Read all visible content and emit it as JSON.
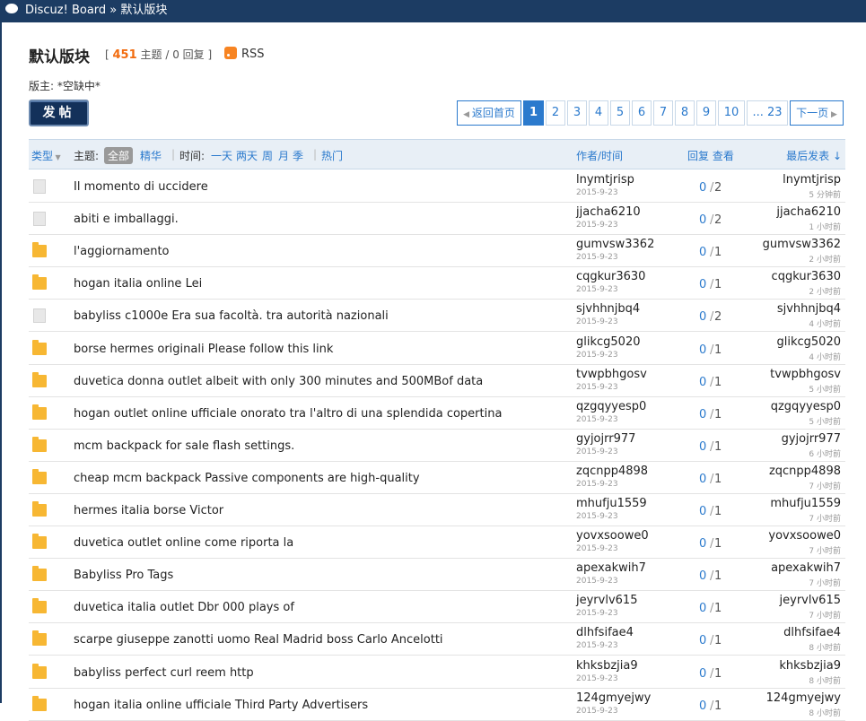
{
  "breadcrumb": {
    "site": "Discuz! Board",
    "separator": "»",
    "current": "默认版块"
  },
  "forum": {
    "title": "默认版块",
    "open_bracket": "[",
    "thread_count": "451",
    "thread_label": "主题",
    "slash": "/",
    "reply_count": "0",
    "reply_label": "回复",
    "close_bracket": "]",
    "rss": "RSS",
    "moderator": "版主: *空缺中*"
  },
  "post_button": "发帖",
  "pager": {
    "prev": "返回首页",
    "pages": [
      "1",
      "2",
      "3",
      "4",
      "5",
      "6",
      "7",
      "8",
      "9",
      "10",
      "... 23"
    ],
    "current": "1",
    "next": "下一页"
  },
  "header": {
    "type": "类型",
    "topic_label": "主题:",
    "all": "全部",
    "digest": "精华",
    "time_sep": "|",
    "time_label": "时间:",
    "day": "一天",
    "two_days": "两天",
    "week": "周",
    "month": "月",
    "season": "季",
    "hot_sep": "|",
    "hot": "热门",
    "author_time": "作者/时间",
    "reply_view": "回复 查看",
    "last_post": "最后发表"
  },
  "threads": [
    {
      "icon": "page",
      "subject": "Il momento di uccidere",
      "author": "lnymtjrisp",
      "date": "2015-9-23",
      "replies": "0",
      "views": "2",
      "last": "lnymtjrisp",
      "ago": "5 分钟前"
    },
    {
      "icon": "page",
      "subject": "abiti e imballaggi.",
      "author": "jjacha6210",
      "date": "2015-9-23",
      "replies": "0",
      "views": "2",
      "last": "jjacha6210",
      "ago": "1 小时前"
    },
    {
      "icon": "folder",
      "subject": "l'aggiornamento",
      "author": "gumvsw3362",
      "date": "2015-9-23",
      "replies": "0",
      "views": "1",
      "last": "gumvsw3362",
      "ago": "2 小时前"
    },
    {
      "icon": "folder",
      "subject": "hogan italia online Lei",
      "author": "cqgkur3630",
      "date": "2015-9-23",
      "replies": "0",
      "views": "1",
      "last": "cqgkur3630",
      "ago": "2 小时前"
    },
    {
      "icon": "page",
      "subject": "babyliss c1000e Era sua facoltà. tra autorità nazionali",
      "author": "sjvhhnjbq4",
      "date": "2015-9-23",
      "replies": "0",
      "views": "2",
      "last": "sjvhhnjbq4",
      "ago": "4 小时前"
    },
    {
      "icon": "folder",
      "subject": "borse hermes originali Please follow this link",
      "author": "glikcg5020",
      "date": "2015-9-23",
      "replies": "0",
      "views": "1",
      "last": "glikcg5020",
      "ago": "4 小时前"
    },
    {
      "icon": "folder",
      "subject": "duvetica donna outlet albeit with only 300 minutes and 500MBof data",
      "author": "tvwpbhgosv",
      "date": "2015-9-23",
      "replies": "0",
      "views": "1",
      "last": "tvwpbhgosv",
      "ago": "5 小时前"
    },
    {
      "icon": "folder",
      "subject": "hogan outlet online ufficiale onorato tra l'altro di una splendida copertina",
      "author": "qzgqyyesp0",
      "date": "2015-9-23",
      "replies": "0",
      "views": "1",
      "last": "qzgqyyesp0",
      "ago": "5 小时前"
    },
    {
      "icon": "folder",
      "subject": "mcm backpack for sale flash settings.",
      "author": "gyjojrr977",
      "date": "2015-9-23",
      "replies": "0",
      "views": "1",
      "last": "gyjojrr977",
      "ago": "6 小时前"
    },
    {
      "icon": "folder",
      "subject": "cheap mcm backpack Passive components are high-quality",
      "author": "zqcnpp4898",
      "date": "2015-9-23",
      "replies": "0",
      "views": "1",
      "last": "zqcnpp4898",
      "ago": "7 小时前"
    },
    {
      "icon": "folder",
      "subject": "hermes italia borse Victor",
      "author": "mhufju1559",
      "date": "2015-9-23",
      "replies": "0",
      "views": "1",
      "last": "mhufju1559",
      "ago": "7 小时前"
    },
    {
      "icon": "folder",
      "subject": "duvetica outlet online come riporta la",
      "author": "yovxsoowe0",
      "date": "2015-9-23",
      "replies": "0",
      "views": "1",
      "last": "yovxsoowe0",
      "ago": "7 小时前"
    },
    {
      "icon": "folder",
      "subject": "Babyliss Pro Tags",
      "author": "apexakwih7",
      "date": "2015-9-23",
      "replies": "0",
      "views": "1",
      "last": "apexakwih7",
      "ago": "7 小时前"
    },
    {
      "icon": "folder",
      "subject": "duvetica italia outlet Dbr 000 plays of",
      "author": "jeyrvlv615",
      "date": "2015-9-23",
      "replies": "0",
      "views": "1",
      "last": "jeyrvlv615",
      "ago": "7 小时前"
    },
    {
      "icon": "folder",
      "subject": "scarpe giuseppe zanotti uomo Real Madrid boss Carlo Ancelotti",
      "author": "dlhfsifae4",
      "date": "2015-9-23",
      "replies": "0",
      "views": "1",
      "last": "dlhfsifae4",
      "ago": "8 小时前"
    },
    {
      "icon": "folder",
      "subject": "babyliss perfect curl reem http",
      "author": "khksbzjia9",
      "date": "2015-9-23",
      "replies": "0",
      "views": "1",
      "last": "khksbzjia9",
      "ago": "8 小时前"
    },
    {
      "icon": "folder",
      "subject": "hogan italia online ufficiale Third Party Advertisers",
      "author": "124gmyejwy",
      "date": "2015-9-23",
      "replies": "0",
      "views": "1",
      "last": "124gmyejwy",
      "ago": "8 小时前"
    }
  ]
}
